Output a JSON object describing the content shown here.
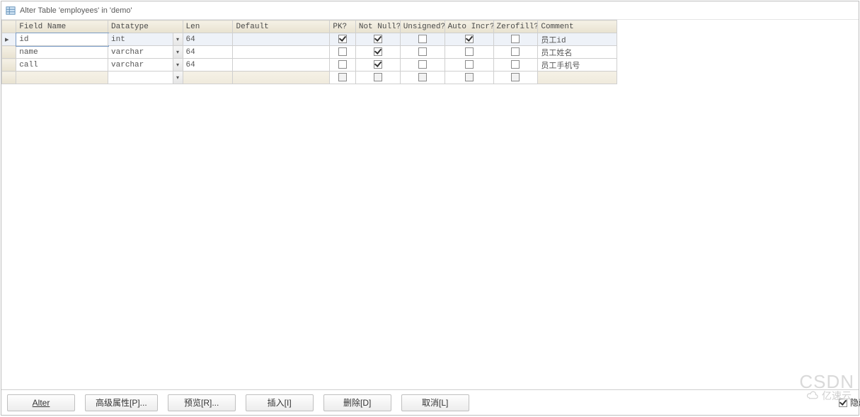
{
  "window": {
    "title": "Alter Table 'employees' in 'demo'"
  },
  "columns": {
    "field_name": "Field Name",
    "datatype": "Datatype",
    "len": "Len",
    "default": "Default",
    "pk": "PK?",
    "not_null": "Not Null?",
    "unsigned": "Unsigned?",
    "auto_incr": "Auto Incr?",
    "zerofill": "Zerofill?",
    "comment": "Comment"
  },
  "rows": [
    {
      "selector": "▸",
      "field": "id",
      "datatype": "int",
      "len": "64",
      "default": "",
      "pk": true,
      "not_null": true,
      "unsigned": false,
      "auto_incr": true,
      "zerofill": false,
      "comment": "员工id",
      "active": true
    },
    {
      "selector": "",
      "field": "name",
      "datatype": "varchar",
      "len": "64",
      "default": "",
      "pk": false,
      "not_null": true,
      "unsigned": false,
      "auto_incr": false,
      "zerofill": false,
      "comment": "员工姓名",
      "active": false
    },
    {
      "selector": "",
      "field": "call",
      "datatype": "varchar",
      "len": "64",
      "default": "",
      "pk": false,
      "not_null": true,
      "unsigned": false,
      "auto_incr": false,
      "zerofill": false,
      "comment": "员工手机号",
      "active": false
    },
    {
      "selector": "",
      "field": "",
      "datatype": "",
      "len": "",
      "default": "",
      "pk": false,
      "not_null": false,
      "unsigned": false,
      "auto_incr": false,
      "zerofill": false,
      "comment": "",
      "active": false,
      "blank": true
    }
  ],
  "buttons": {
    "alter": "Alter",
    "advanced": "高级属性[P]...",
    "preview": "预览[R]...",
    "insert": "插入[I]",
    "delete": "删除[D]",
    "cancel": "取消[L]"
  },
  "hide_checkbox": {
    "checked": true,
    "label": "隐藏"
  },
  "watermark1": "CSDN",
  "watermark2": "亿速云"
}
